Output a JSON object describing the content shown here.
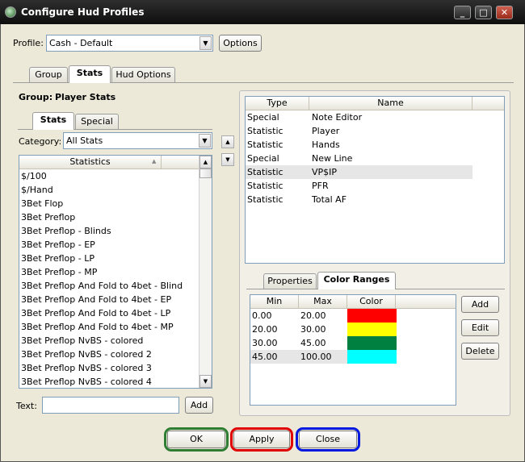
{
  "window": {
    "title": "Configure Hud Profiles",
    "controls": {
      "minimize": "_",
      "maximize": "□",
      "close": "✕"
    }
  },
  "profile": {
    "label": "Profile:",
    "value": "Cash - Default",
    "options_button": "Options"
  },
  "main_tabs": [
    {
      "label": "Group"
    },
    {
      "label": "Stats",
      "active": true
    },
    {
      "label": "Hud Options"
    }
  ],
  "group": {
    "label": "Group:",
    "value": "Player Stats"
  },
  "sub_tabs": [
    {
      "label": "Stats",
      "active": true
    },
    {
      "label": "Special"
    }
  ],
  "category": {
    "label": "Category:",
    "value": "All Stats"
  },
  "statistics": {
    "header": "Statistics",
    "items": [
      "$/100",
      "$/Hand",
      "3Bet Flop",
      "3Bet Preflop",
      "3Bet Preflop - Blinds",
      "3Bet Preflop - EP",
      "3Bet Preflop - LP",
      "3Bet Preflop - MP",
      "3Bet Preflop And Fold to 4bet - Blind",
      "3Bet Preflop And Fold to 4bet - EP",
      "3Bet Preflop And Fold to 4bet - LP",
      "3Bet Preflop And Fold to 4bet - MP",
      "3Bet Preflop NvBS - colored",
      "3Bet Preflop NvBS - colored 2",
      "3Bet Preflop NvBS - colored 3",
      "3Bet Preflop NvBS - colored 4"
    ]
  },
  "text_field": {
    "label": "Text:",
    "value": "",
    "add_button": "Add"
  },
  "selected_stats": {
    "columns": [
      "Type",
      "Name"
    ],
    "rows": [
      {
        "type": "Special",
        "name": "Note Editor"
      },
      {
        "type": "Statistic",
        "name": "Player"
      },
      {
        "type": "Statistic",
        "name": "Hands"
      },
      {
        "type": "Special",
        "name": "New Line"
      },
      {
        "type": "Statistic",
        "name": "VP$IP",
        "selected": true
      },
      {
        "type": "Statistic",
        "name": "PFR"
      },
      {
        "type": "Statistic",
        "name": "Total AF"
      }
    ]
  },
  "detail_tabs": [
    {
      "label": "Properties"
    },
    {
      "label": "Color Ranges",
      "active": true
    }
  ],
  "color_ranges": {
    "columns": [
      "Min",
      "Max",
      "Color"
    ],
    "rows": [
      {
        "min": "0.00",
        "max": "20.00",
        "color": "#ff0000"
      },
      {
        "min": "20.00",
        "max": "30.00",
        "color": "#ffff00"
      },
      {
        "min": "30.00",
        "max": "45.00",
        "color": "#008040"
      },
      {
        "min": "45.00",
        "max": "100.00",
        "color": "#00ffff",
        "selected": true
      }
    ],
    "buttons": {
      "add": "Add",
      "edit": "Edit",
      "delete": "Delete"
    }
  },
  "footer": {
    "ok": {
      "label": "OK",
      "ring_color": "#2e7d32"
    },
    "apply": {
      "label": "Apply",
      "ring_color": "#e00000"
    },
    "close": {
      "label": "Close",
      "ring_color": "#0018e0"
    }
  }
}
